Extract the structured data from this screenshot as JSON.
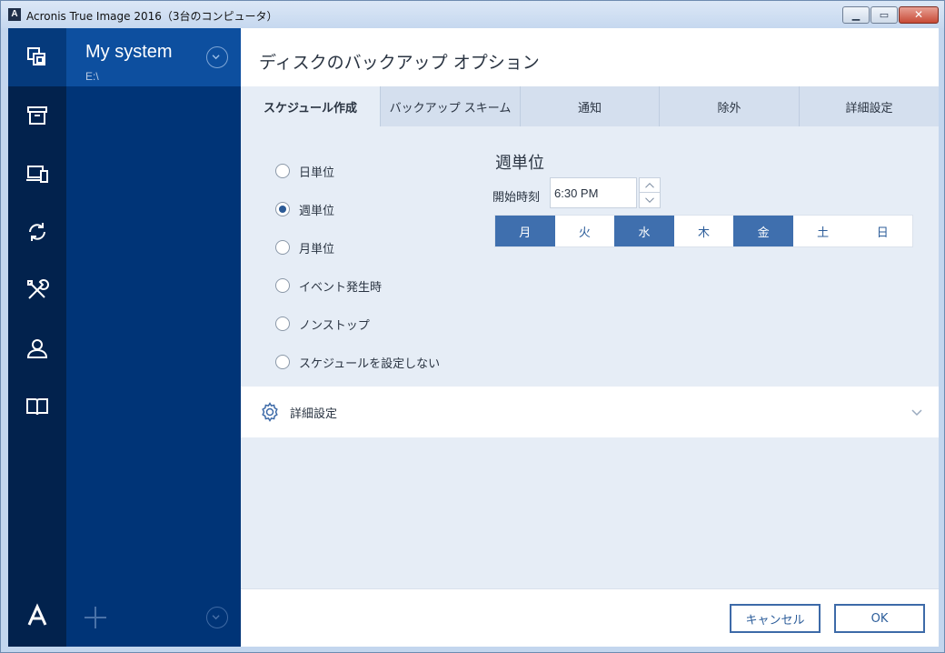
{
  "window": {
    "title": "Acronis True Image 2016（3台のコンピュータ）",
    "app_icon_letter": "A"
  },
  "rail": {
    "items": [
      {
        "icon": "backup-icon",
        "active": true
      },
      {
        "icon": "archive-icon",
        "active": false
      },
      {
        "icon": "devices-icon",
        "active": false
      },
      {
        "icon": "sync-icon",
        "active": false
      },
      {
        "icon": "tools-icon",
        "active": false
      },
      {
        "icon": "account-icon",
        "active": false
      },
      {
        "icon": "help-book-icon",
        "active": false
      }
    ],
    "logo_letter": "A"
  },
  "source": {
    "title": "My system",
    "subtitle": "E:\\"
  },
  "main": {
    "title": "ディスクのバックアップ オプション",
    "tabs": [
      {
        "label": "スケジュール作成",
        "active": true
      },
      {
        "label": "バックアップ スキーム",
        "active": false
      },
      {
        "label": "通知",
        "active": false
      },
      {
        "label": "除外",
        "active": false
      },
      {
        "label": "詳細設定",
        "active": false
      }
    ],
    "schedule_options": [
      {
        "label": "日単位",
        "checked": false
      },
      {
        "label": "週単位",
        "checked": true
      },
      {
        "label": "月単位",
        "checked": false
      },
      {
        "label": "イベント発生時",
        "checked": false
      },
      {
        "label": "ノンストップ",
        "checked": false
      },
      {
        "label": "スケジュールを設定しない",
        "checked": false
      }
    ],
    "weekly": {
      "title": "週単位",
      "start_label": "開始時刻",
      "start_time": "6:30 PM",
      "days": [
        {
          "label": "月",
          "selected": true
        },
        {
          "label": "火",
          "selected": false
        },
        {
          "label": "水",
          "selected": true
        },
        {
          "label": "木",
          "selected": false
        },
        {
          "label": "金",
          "selected": true
        },
        {
          "label": "土",
          "selected": false
        },
        {
          "label": "日",
          "selected": false
        }
      ]
    },
    "advanced_label": "詳細設定"
  },
  "footer": {
    "cancel_label": "キャンセル",
    "ok_label": "OK"
  },
  "colors": {
    "rail_bg": "#02224d",
    "source_bg": "#003477",
    "source_header": "#0d4f9f",
    "accent": "#3f6fae"
  }
}
